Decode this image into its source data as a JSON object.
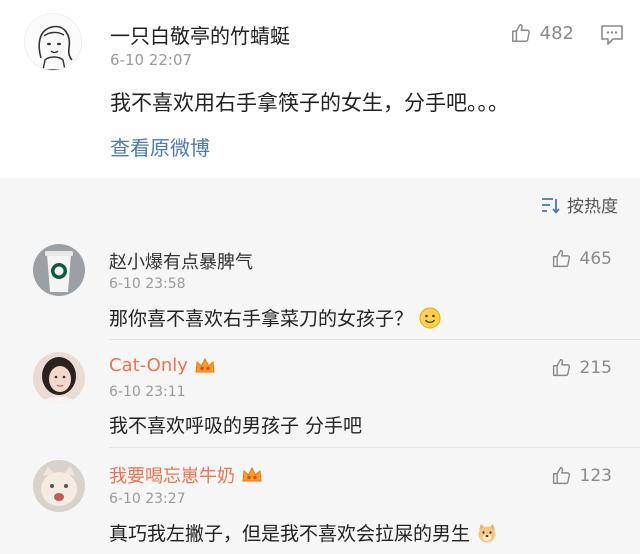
{
  "post": {
    "author": "一只白敬亭的竹蜻蜓",
    "time": "6-10 22:07",
    "likes": "482",
    "text": "我不喜欢用右手拿筷子的女生，分手吧。。。",
    "view_original": "查看原微博"
  },
  "comments_section": {
    "sort_label": "按热度",
    "items": [
      {
        "name": "赵小爆有点暴脾气",
        "time": "6-10 23:58",
        "likes": "465",
        "text": "那你喜不喜欢右手拿菜刀的女孩子？",
        "emoji": "smile-emoji",
        "vip": false
      },
      {
        "name": "Cat-Only",
        "time": "6-10 23:11",
        "likes": "215",
        "text": "我不喜欢呼吸的男孩子 分手吧",
        "vip": true
      },
      {
        "name": "我要喝忘崽牛奶",
        "time": "6-10 23:27",
        "likes": "123",
        "text": "真巧我左撇子，但是我不喜欢会拉屎的男生",
        "emoji": "doge-emoji",
        "vip": true
      }
    ]
  },
  "colors": {
    "link": "#4b7aae",
    "vip_name": "#eb7350",
    "comments_bg": "#f6f6f6"
  }
}
